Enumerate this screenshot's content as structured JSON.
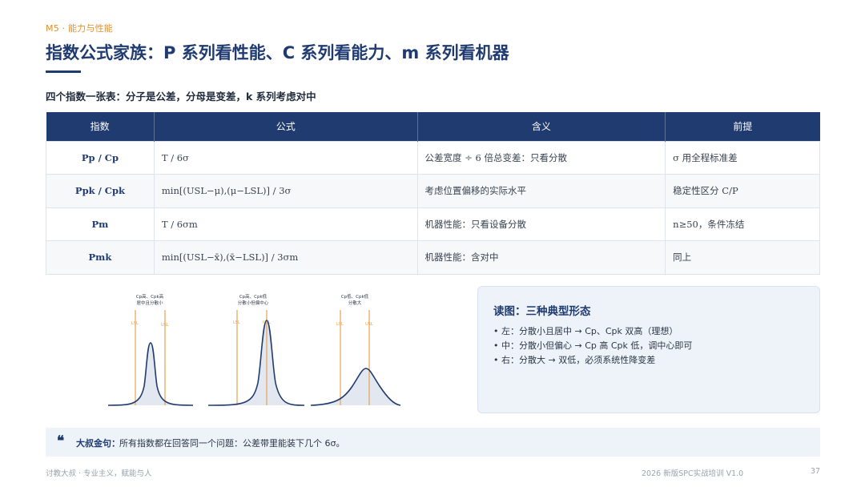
{
  "header": {
    "section_tag": "M5 · 能力与性能",
    "title": "指数公式家族：P 系列看性能、C 系列看能力、m 系列看机器",
    "subtitle": "四个指数一张表：分子是公差，分母是变差，k 系列考虑对中"
  },
  "table": {
    "headers": [
      "指数",
      "公式",
      "含义",
      "前提"
    ],
    "rows": [
      [
        "Pp / Cp",
        "T / 6σ",
        "公差宽度 ÷ 6 倍总变差：只看分散",
        "σ 用全程标准差"
      ],
      [
        "Ppk / Cpk",
        "min[(USL−μ),(μ−LSL)] / 3σ",
        "考虑位置偏移的实际水平",
        "稳定性区分 C/P"
      ],
      [
        "Pm",
        "T / 6σm",
        "机器性能：只看设备分散",
        "n≥50，条件冻结"
      ],
      [
        "Pmk",
        "min[(USL−x̄),(x̄−LSL)] / 3σm",
        "机器性能：含对中",
        "同上"
      ]
    ]
  },
  "curves": [
    {
      "label_line1": "Cp高、Cpk高",
      "label_line2": "居中且分散小",
      "lsl": "LSL",
      "usl": "USL"
    },
    {
      "label_line1": "Cp高、Cpk低",
      "label_line2": "分散小但偏中心",
      "lsl": "LSL",
      "usl": "USL"
    },
    {
      "label_line1": "Cp低、Cpk低",
      "label_line2": "分散大",
      "lsl": "LSL",
      "usl": "USL"
    }
  ],
  "read_card": {
    "title": "读图：三种典型形态",
    "bullet": "•",
    "items": [
      "左：分散小且居中 → Cp、Cpk 双高（理想）",
      "中：分散小但偏心 → Cp 高 Cpk 低，调中心即可",
      "右：分散大 → 双低，必须系统性降变差"
    ]
  },
  "quote": {
    "icon": "❝",
    "label": "大叔金句：",
    "text": "所有指数都在回答同一个问题：公差带里能装下几个 6σ。"
  },
  "footer": {
    "left": "讨教大叔 · 专业主义，赋能与人",
    "right": "2026 新版SPC实战培训 V1.0",
    "page": "37"
  },
  "colors": {
    "primary": "#1f3b70",
    "accent": "#e0902a",
    "spec_line": "#e6a24f",
    "curve_fill": "#e2e7f0"
  }
}
